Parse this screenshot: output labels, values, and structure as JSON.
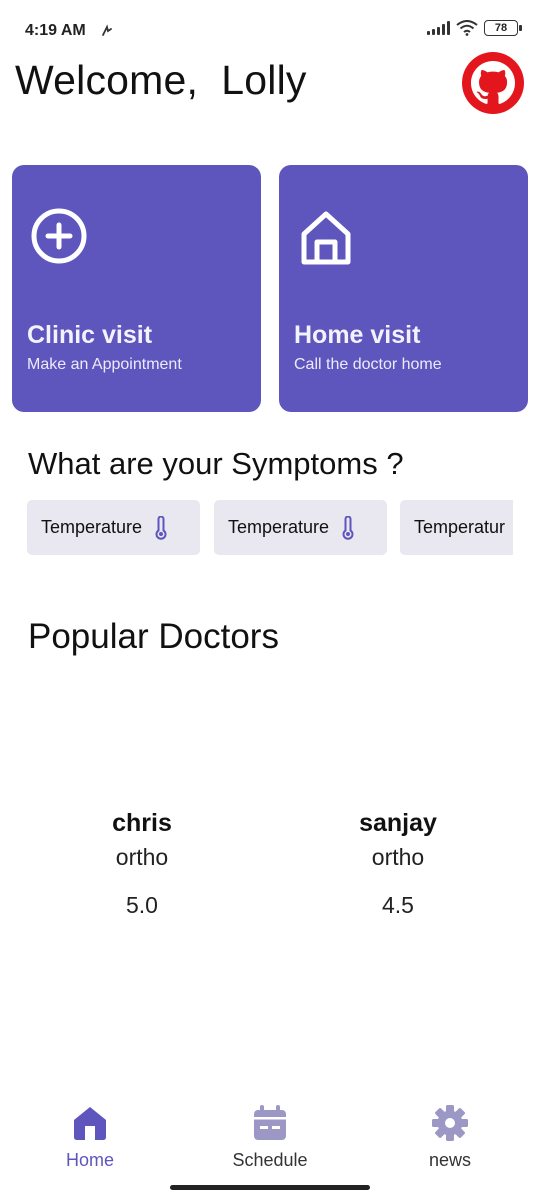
{
  "status_bar": {
    "time": "4:19 AM",
    "battery": "78"
  },
  "header": {
    "welcome_text": "Welcome,  Lolly",
    "avatar_icon": "github-icon"
  },
  "cards": [
    {
      "title": "Clinic visit",
      "subtitle": "Make an Appointment",
      "icon": "plus-circle-icon"
    },
    {
      "title": "Home visit",
      "subtitle": "Call the doctor home",
      "icon": "house-icon"
    }
  ],
  "symptoms": {
    "title": "What are your Symptoms ?",
    "chips": [
      {
        "label": "Temperature",
        "icon": "thermometer-icon"
      },
      {
        "label": "Temperature",
        "icon": "thermometer-icon"
      },
      {
        "label": "Temperatur",
        "icon": "thermometer-icon"
      }
    ]
  },
  "doctors": {
    "title": "Popular Doctors",
    "items": [
      {
        "name": "chris",
        "specialty": "ortho",
        "rating": "5.0"
      },
      {
        "name": "sanjay",
        "specialty": "ortho",
        "rating": "4.5"
      }
    ]
  },
  "bottom_nav": {
    "items": [
      {
        "label": "Home",
        "icon": "home-icon",
        "active": true
      },
      {
        "label": "Schedule",
        "icon": "calendar-icon",
        "active": false
      },
      {
        "label": "news",
        "icon": "gear-icon",
        "active": false
      }
    ]
  },
  "colors": {
    "accent": "#5e55bd",
    "github_red": "#e4161d",
    "chip_bg": "#e9e8f0",
    "nav_inactive": "#9c98c6"
  }
}
